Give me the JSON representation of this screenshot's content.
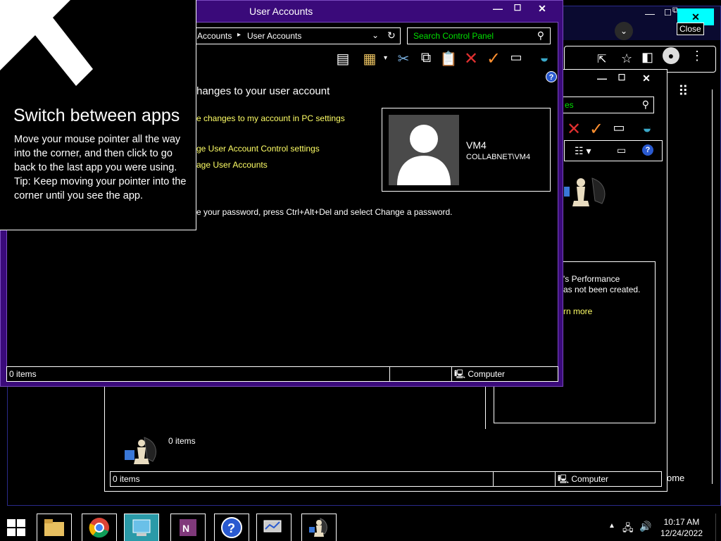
{
  "main_window": {
    "title": "User Accounts",
    "breadcrumb": [
      "Accounts",
      "User Accounts"
    ],
    "search_placeholder": "Search Control Panel",
    "heading": "hanges to your user account",
    "links": [
      "e changes to my account in PC settings",
      "ge User Account Control settings",
      "age User Accounts"
    ],
    "password_note": "e your password, press Ctrl+Alt+Del and select Change a password.",
    "user": {
      "name": "VM4",
      "domain": "COLLABNET\\VM4"
    },
    "status_items": "0 items",
    "status_computer": "Computer"
  },
  "second_window": {
    "search_partial": "es",
    "perf_line1": "'s Performance",
    "perf_line2": "as not been created.",
    "learn_more": "rn more",
    "items_label": "0 items",
    "status_items": "0 items",
    "status_computer": "Computer",
    "edge_text": "ome"
  },
  "browser": {
    "close_tooltip": "Close"
  },
  "tip": {
    "title": "Switch between apps",
    "body_1": "Move your mouse pointer all the way into the corner, and then click to go back to the last app you were using.",
    "body_2": "Tip: Keep moving your pointer into the corner until you see the app."
  },
  "taskbar": {
    "apps": [
      "start",
      "file-explorer",
      "chrome",
      "control-panel",
      "onenote",
      "help",
      "performance-monitor",
      "games"
    ],
    "time": "10:17 AM",
    "date": "12/24/2022"
  },
  "colors": {
    "title_bar": "#3a0a7a",
    "link": "#ffff66",
    "search_text": "#00e000",
    "close_highlight": "#00ffff",
    "taskbar_active": "#2a9aa8"
  }
}
